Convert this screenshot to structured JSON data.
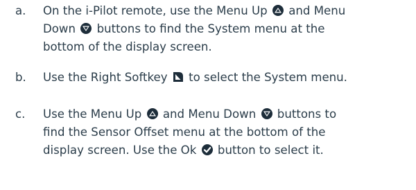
{
  "steps": [
    {
      "marker": "a.",
      "parts": [
        "On the i-Pilot remote, use the Menu Up",
        "and Menu",
        "Down",
        "buttons to find the System menu at the",
        "bottom of the display screen."
      ]
    },
    {
      "marker": "b.",
      "parts": [
        "Use the Right Softkey",
        "to select the System menu."
      ]
    },
    {
      "marker": "c.",
      "parts": [
        "Use the Menu Up",
        "and Menu Down",
        "buttons to",
        "find the Sensor Offset menu at the bottom of the",
        "display screen. Use the Ok",
        "button to select it."
      ]
    }
  ],
  "icons": {
    "menu_up": "triangle-up-icon",
    "menu_down": "triangle-down-icon",
    "right_softkey": "right-softkey-icon",
    "ok": "ok-check-icon"
  },
  "colors": {
    "text": "#2b3d4a",
    "icon": "#1d2d3a"
  }
}
